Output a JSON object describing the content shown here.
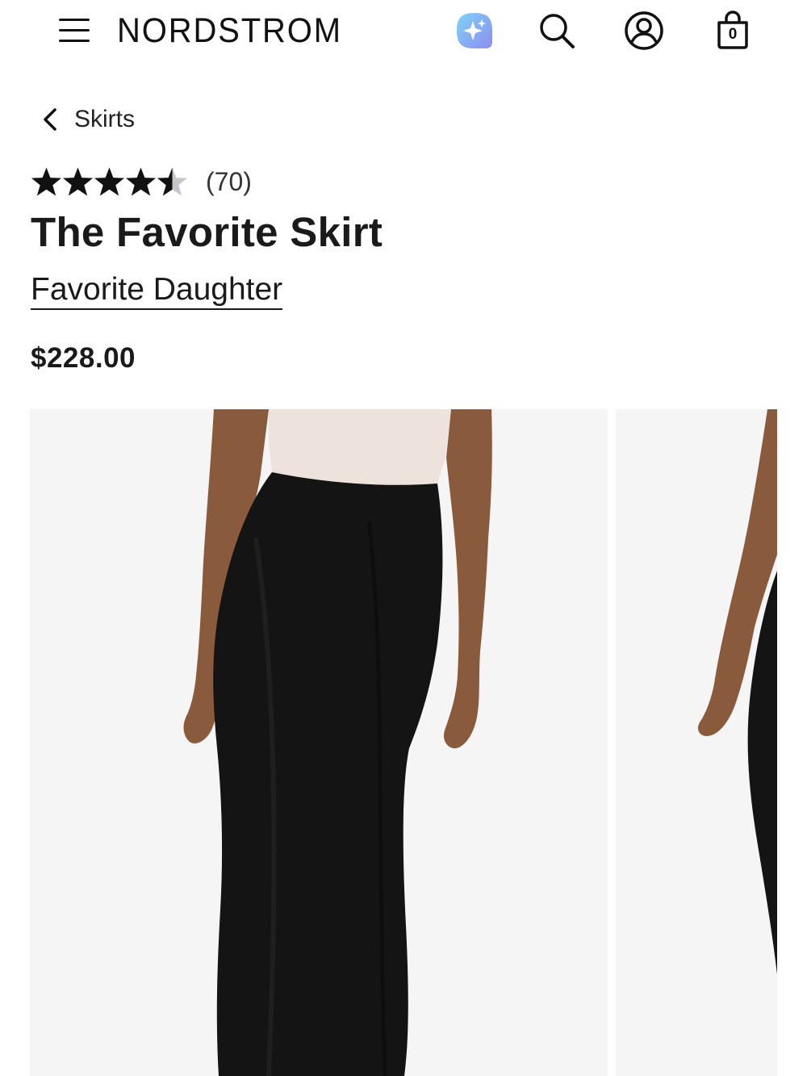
{
  "header": {
    "logo": "NORDSTROM",
    "menu_icon": "hamburger-menu-icon",
    "ai_icon": "sparkle-assistant-icon",
    "search_icon": "search-icon",
    "account_icon": "account-icon",
    "bag_icon": "shopping-bag-icon",
    "bag_count": "0",
    "ai_color": "#5db8f0"
  },
  "breadcrumb": {
    "label": "Skirts",
    "icon": "chevron-left-icon"
  },
  "product": {
    "rating": 4.5,
    "rating_max": 5,
    "review_count": "(70)",
    "title": "The Favorite Skirt",
    "brand": "Favorite Daughter",
    "price": "$228.00"
  },
  "gallery": {
    "images": [
      {
        "alt": "model wearing black satin midi skirt, front view"
      },
      {
        "alt": "model wearing black satin midi skirt, side view"
      }
    ]
  }
}
